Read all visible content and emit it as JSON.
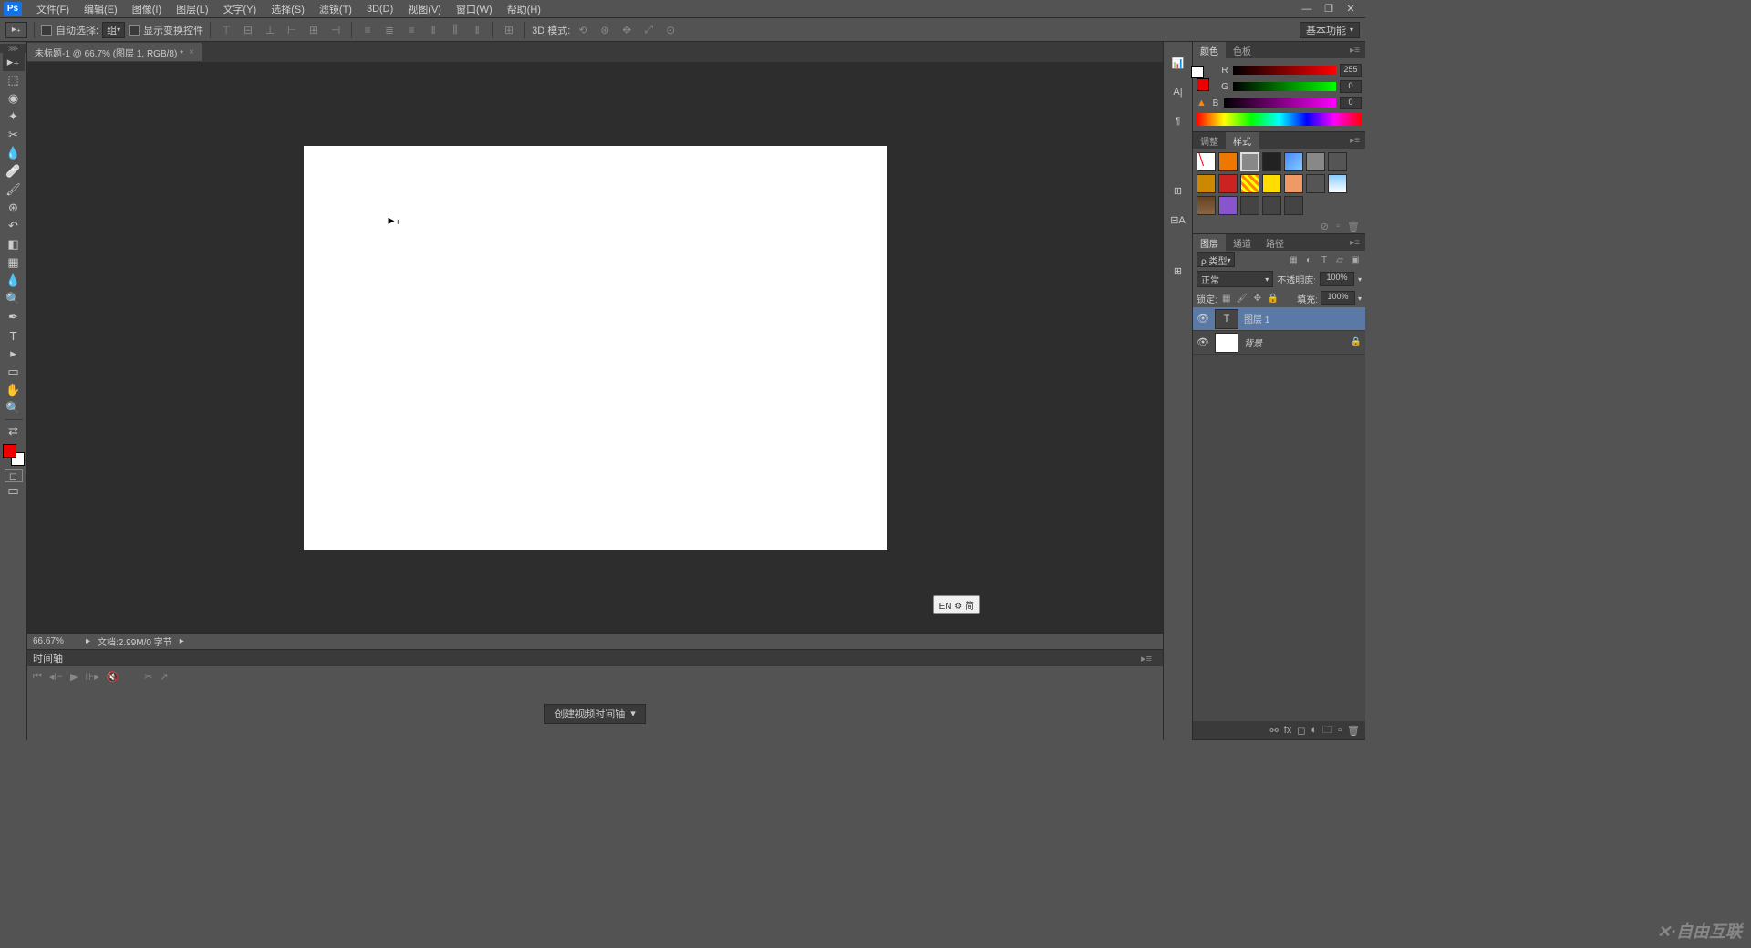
{
  "app": {
    "logo": "Ps"
  },
  "menu": {
    "file": "文件(F)",
    "edit": "编辑(E)",
    "image": "图像(I)",
    "layer": "图层(L)",
    "type": "文字(Y)",
    "select": "选择(S)",
    "filter": "滤镜(T)",
    "threed": "3D(D)",
    "view": "视图(V)",
    "window": "窗口(W)",
    "help": "帮助(H)"
  },
  "optbar": {
    "auto_select": "自动选择:",
    "group": "组",
    "show_transform": "显示变换控件",
    "threed_mode": "3D 模式:"
  },
  "workspace": "基本功能",
  "doctab": {
    "title": "未标题-1 @ 66.7% (图层 1, RGB/8) *"
  },
  "status": {
    "zoom": "66.67%",
    "doc": "文档:2.99M/0 字节"
  },
  "timeline": {
    "title": "时间轴",
    "create": "创建视频时间轴"
  },
  "colorpanel": {
    "tab_color": "颜色",
    "tab_swatches": "色板",
    "r_label": "R",
    "g_label": "G",
    "b_label": "B",
    "r_val": "255",
    "g_val": "0",
    "b_val": "0"
  },
  "stylespanel": {
    "tab_adjust": "调整",
    "tab_styles": "样式"
  },
  "layerspanel": {
    "tab_layers": "图层",
    "tab_channels": "通道",
    "tab_paths": "路径",
    "kind": "ρ 类型",
    "blend": "正常",
    "opacity_label": "不透明度:",
    "opacity_val": "100%",
    "lock_label": "锁定:",
    "fill_label": "填充:",
    "fill_val": "100%",
    "layers": [
      {
        "name": "图层 1",
        "type": "text",
        "selected": true,
        "locked": false
      },
      {
        "name": "背景",
        "type": "bg",
        "selected": false,
        "locked": true
      }
    ]
  },
  "ime": "EN ⚙ 简",
  "watermark": "✕·自由互联"
}
